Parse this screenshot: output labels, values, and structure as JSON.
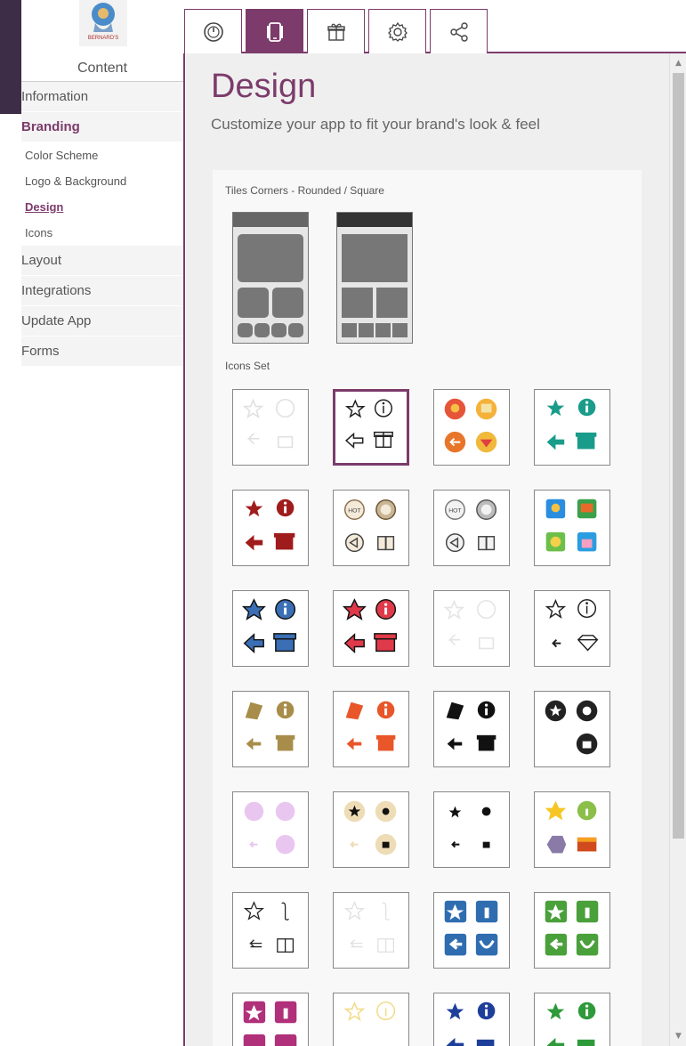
{
  "tabs": [
    {
      "icon": "dashboard-icon",
      "active": false
    },
    {
      "icon": "mobile-device-icon",
      "active": true
    },
    {
      "icon": "gift-icon",
      "active": false
    },
    {
      "icon": "gear-icon",
      "active": false
    },
    {
      "icon": "share-icon",
      "active": false
    }
  ],
  "sidebar": {
    "header": "Content",
    "items": {
      "information": "Information",
      "branding": "Branding",
      "color_scheme": "Color Scheme",
      "logo_background": "Logo & Background",
      "design": "Design",
      "icons": "Icons",
      "layout": "Layout",
      "integrations": "Integrations",
      "update_app": "Update App",
      "forms": "Forms"
    }
  },
  "main": {
    "title": "Design",
    "subtitle": "Customize your app to fit your brand's look & feel",
    "tiles_label": "Tiles Corners - Rounded / Square",
    "icons_label": "Icons Set",
    "selected_icon_set": 2
  },
  "colors": {
    "accent": "#7c3b6b",
    "header_band": "#3d2d47"
  }
}
